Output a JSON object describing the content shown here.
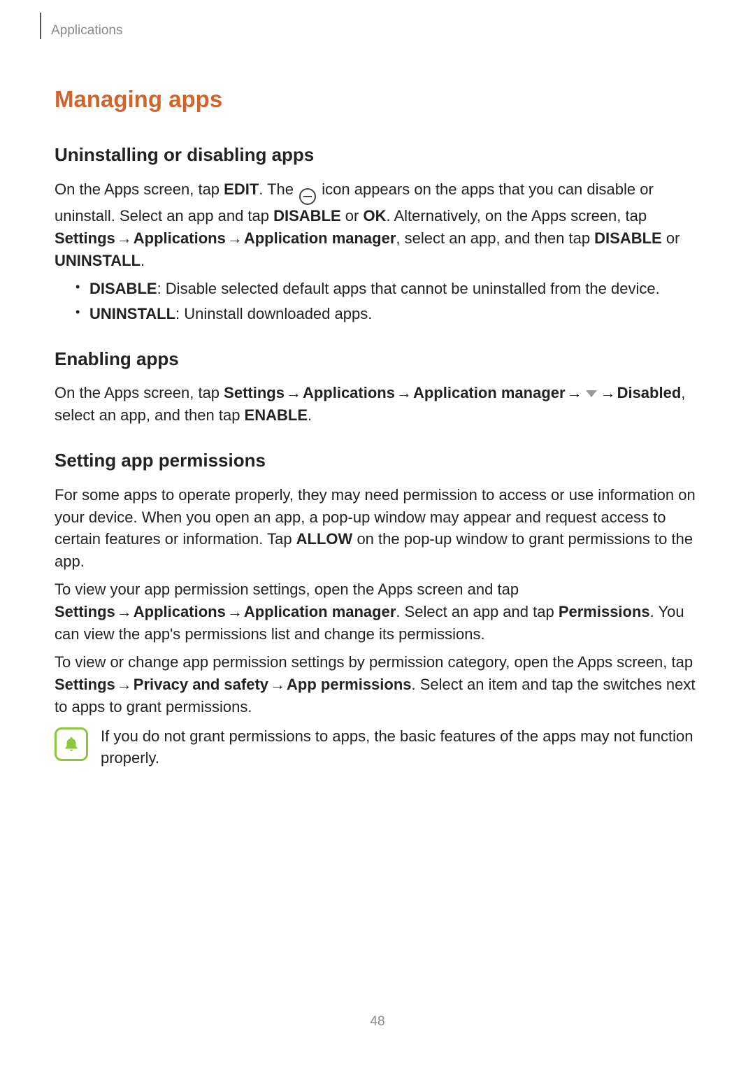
{
  "header": {
    "running": "Applications"
  },
  "h1": "Managing apps",
  "sections": {
    "uninstall": {
      "heading": "Uninstalling or disabling apps",
      "p1_a": "On the Apps screen, tap ",
      "p1_edit": "EDIT",
      "p1_b": ". The ",
      "p1_c": " icon appears on the apps that you can disable or uninstall. Select an app and tap ",
      "p1_disable": "DISABLE",
      "p1_or": " or ",
      "p1_ok": "OK",
      "p1_d": ". Alternatively, on the Apps screen, tap ",
      "p1_settings": "Settings",
      "p1_apps": "Applications",
      "p1_appmgr": "Application manager",
      "p1_e": ", select an app, and then tap ",
      "p1_disable2": "DISABLE",
      "p1_or2": " or ",
      "p1_uninstall": "UNINSTALL",
      "p1_period": ".",
      "bul1_b": "DISABLE",
      "bul1_t": ": Disable selected default apps that cannot be uninstalled from the device.",
      "bul2_b": "UNINSTALL",
      "bul2_t": ": Uninstall downloaded apps."
    },
    "enable": {
      "heading": "Enabling apps",
      "p_a": "On the Apps screen, tap ",
      "settings": "Settings",
      "apps": "Applications",
      "appmgr": "Application manager",
      "disabled": "Disabled",
      "p_b": ", select an app, and then tap ",
      "enable": "ENABLE",
      "period": "."
    },
    "perm": {
      "heading": "Setting app permissions",
      "p1_a": "For some apps to operate properly, they may need permission to access or use information on your device. When you open an app, a pop-up window may appear and request access to certain features or information. Tap ",
      "allow": "ALLOW",
      "p1_b": " on the pop-up window to grant permissions to the app.",
      "p2_a": "To view your app permission settings, open the Apps screen and tap ",
      "settings": "Settings",
      "apps": "Applications",
      "appmgr": "Application manager",
      "p2_b": ". Select an app and tap ",
      "permissions": "Permissions",
      "p2_c": ". You can view the app's permissions list and change its permissions.",
      "p3_a": "To view or change app permission settings by permission category, open the Apps screen, tap ",
      "privacy": "Privacy and safety",
      "appperm": "App permissions",
      "p3_b": ". Select an item and tap the switches next to apps to grant permissions.",
      "note": "If you do not grant permissions to apps, the basic features of the apps may not function properly."
    }
  },
  "arrow": "→",
  "page": "48"
}
